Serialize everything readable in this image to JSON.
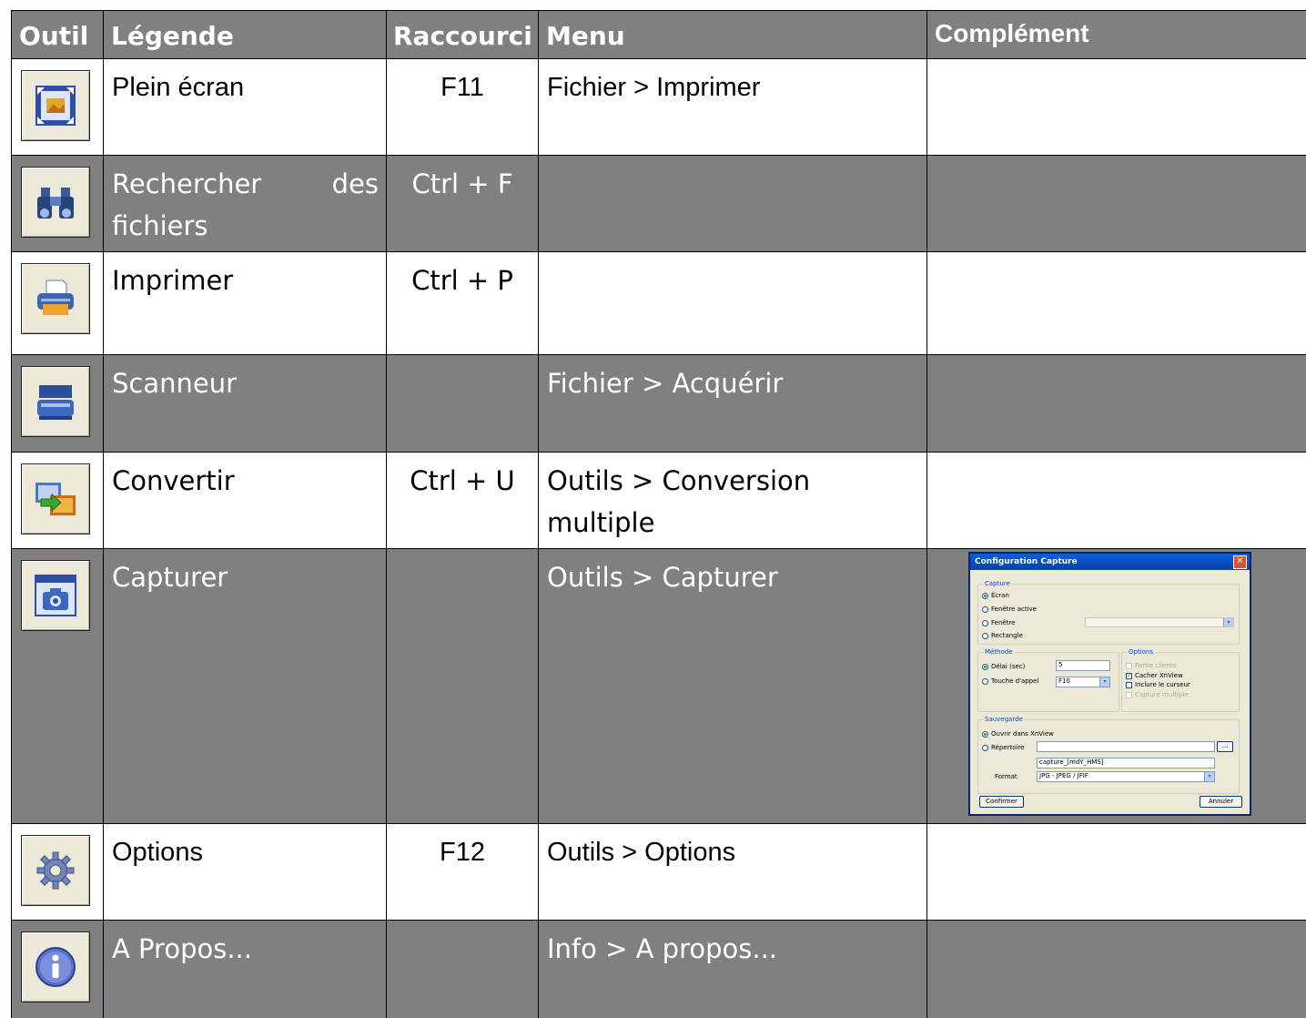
{
  "header": {
    "col_outil": "Outil",
    "col_legende": "Légende",
    "col_raccourci": "Raccourci",
    "col_menu": "Menu",
    "col_complement": "Complément"
  },
  "rows": [
    {
      "icon": "fullscreen-icon",
      "legende": "Plein écran",
      "raccourci": "F11",
      "menu": "Fichier > Imprimer",
      "style": "white"
    },
    {
      "icon": "binoculars-icon",
      "legende_a": "Rechercher",
      "legende_b": "des",
      "legende_c": "fichiers",
      "raccourci": "Ctrl + F",
      "menu": "",
      "style": "grey"
    },
    {
      "icon": "printer-icon",
      "legende": "Imprimer",
      "raccourci": "Ctrl + P",
      "menu": "",
      "style": "white"
    },
    {
      "icon": "scanner-icon",
      "legende": "Scanneur",
      "raccourci": "",
      "menu": "Fichier > Acquérir",
      "style": "grey"
    },
    {
      "icon": "convert-icon",
      "legende": "Convertir",
      "raccourci": "Ctrl + U",
      "menu": "Outils > Conversion multiple",
      "style": "white"
    },
    {
      "icon": "camera-icon",
      "legende": "Capturer",
      "raccourci": "",
      "menu": "Outils > Capturer",
      "style": "grey"
    },
    {
      "icon": "gear-icon",
      "legende": "Options",
      "raccourci": "F12",
      "menu": "Outils > Options",
      "style": "white"
    },
    {
      "icon": "info-icon",
      "legende": "A Propos...",
      "raccourci": "",
      "menu": "Info > A propos...",
      "style": "grey"
    }
  ],
  "dialog": {
    "title": "Configuration Capture",
    "capture_group": "Capture",
    "opt_ecran": "Écran",
    "opt_fenetre_active": "Fenêtre active",
    "opt_fenetre": "Fenêtre",
    "opt_rectangle": "Rectangle",
    "methode_group": "Méthode",
    "opt_delai": "Délai (sec)",
    "delai_value": "5",
    "opt_touche": "Touche d'appel",
    "touche_value": "F10",
    "options_group": "Options",
    "chk_partie_cliente": "Partie cliente",
    "chk_cacher": "Cacher XnView",
    "chk_curseur": "Inclure le curseur",
    "chk_multiple": "Capture multiple",
    "sauvegarde_group": "Sauvegarde",
    "opt_ouvrir": "Ouvrir dans XnView",
    "opt_repertoire": "Répertoire",
    "browse_label": "...",
    "filename_value": "capture_[mdY_HMS]",
    "format_label": "Format",
    "format_value": "JPG - JPEG / JFIF",
    "confirm_label": "Confirmer",
    "cancel_label": "Annuler"
  }
}
